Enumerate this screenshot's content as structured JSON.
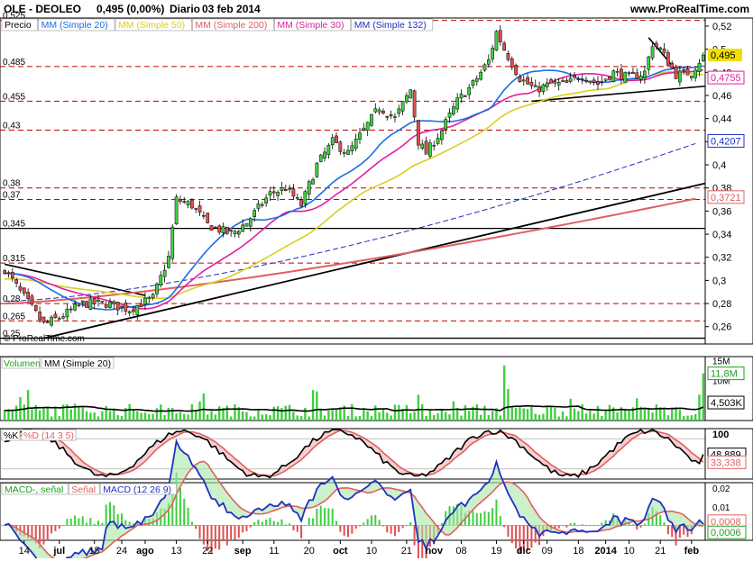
{
  "header": {
    "symbol": "OLE - DEOLEO",
    "price_change": "0,495 (0,00%)",
    "period": "Diario",
    "date": "03 feb 2014",
    "site": "www.ProRealTime.com"
  },
  "legend_price": [
    {
      "label": "Precio",
      "color": "#000000",
      "bg": "#ffffff"
    },
    {
      "label": "MM (Simple 20)",
      "color": "#1a6ee8",
      "bg": "#ffffff"
    },
    {
      "label": "MM (Simple 50)",
      "color": "#d8d020",
      "bg": "#ffffff"
    },
    {
      "label": "MM (Simple 200)",
      "color": "#e06060",
      "bg": "#ffffff"
    },
    {
      "label": "MM (Simple 30)",
      "color": "#e020a0",
      "bg": "#ffffff"
    },
    {
      "label": "MM (Simple 132)",
      "color": "#2030c0",
      "bg": "#ffffff"
    }
  ],
  "watermark": "© ProRealTime.com",
  "chart_data": [
    {
      "type": "candlestick",
      "panel": "price",
      "ylim": [
        0.245,
        0.527
      ],
      "y_ticks": [
        "0,52",
        "0,5",
        "0,48",
        "0,46",
        "0,44",
        "0,42",
        "0,4",
        "0,38",
        "0,36",
        "0,34",
        "0,32",
        "0,3",
        "0,28",
        "0,26"
      ],
      "y_tick_values": [
        0.52,
        0.5,
        0.48,
        0.46,
        0.44,
        0.42,
        0.4,
        0.38,
        0.36,
        0.34,
        0.32,
        0.3,
        0.28,
        0.26
      ],
      "level_labels": [
        "0,525",
        "0,485",
        "0,455",
        "0,43",
        "0,38",
        "0,37",
        "0,345",
        "0,315",
        "0,28",
        "0,265",
        "0,25"
      ],
      "level_values": [
        0.525,
        0.485,
        0.455,
        0.43,
        0.38,
        0.37,
        0.345,
        0.315,
        0.28,
        0.265,
        0.25
      ],
      "last_price": {
        "label": "0,495",
        "value": 0.495,
        "color": "#000000",
        "bg": "#f0e000"
      },
      "ma_badges": [
        {
          "label": "0,4755",
          "value": 0.4755,
          "color": "#e020a0"
        },
        {
          "label": "0,4207",
          "value": 0.4207,
          "color": "#2030c0"
        },
        {
          "label": "0,3721",
          "value": 0.3721,
          "color": "#e06060"
        }
      ],
      "x_labels": [
        "14",
        "jul",
        "15",
        "24",
        "ago",
        "13",
        "22",
        "sep",
        "11",
        "20",
        "oct",
        "10",
        "21",
        "nov",
        "08",
        "19",
        "dic",
        "09",
        "18",
        "2014",
        "10",
        "21",
        "feb"
      ],
      "x_label_bars": [
        5,
        14,
        23,
        30,
        36,
        44,
        52,
        61,
        69,
        78,
        86,
        94,
        103,
        110,
        117,
        126,
        133,
        139,
        147,
        154,
        160,
        168,
        176
      ]
    },
    {
      "type": "bar",
      "panel": "volume",
      "legend": [
        "Volumen",
        "MM (Simple 20)"
      ],
      "y_ticks": [
        "15M",
        "10M"
      ],
      "y_tick_values": [
        15,
        10
      ],
      "ylim": [
        0,
        16
      ],
      "badges": [
        {
          "label": "11,8M",
          "value": 11.8,
          "color": "#20a020"
        },
        {
          "label": "4,503K",
          "value": 4.503,
          "color": "#000000"
        }
      ]
    },
    {
      "type": "line",
      "panel": "stochastic",
      "legend": [
        "%K",
        "%D (14 3 5)"
      ],
      "y_ticks": [
        "100"
      ],
      "y_tick_values": [
        100
      ],
      "ylim": [
        0,
        100
      ],
      "badges": [
        {
          "label": "48,889",
          "value": 48.889,
          "color": "#000000"
        },
        {
          "label": "33,338",
          "value": 33.338,
          "color": "#e06060"
        }
      ]
    },
    {
      "type": "line",
      "panel": "macd",
      "legend": [
        "MACD-, señal",
        "Señal",
        "MACD (12 26 9)"
      ],
      "y_ticks": [
        "0,02",
        "0,01"
      ],
      "y_tick_values": [
        0.02,
        0.01
      ],
      "ylim": [
        -0.008,
        0.023
      ],
      "badges": [
        {
          "label": "0,0008",
          "value": 0.0008,
          "color": "#e06060"
        },
        {
          "label": "0,0006",
          "value": 0.0006,
          "color": "#20a020"
        }
      ]
    }
  ]
}
